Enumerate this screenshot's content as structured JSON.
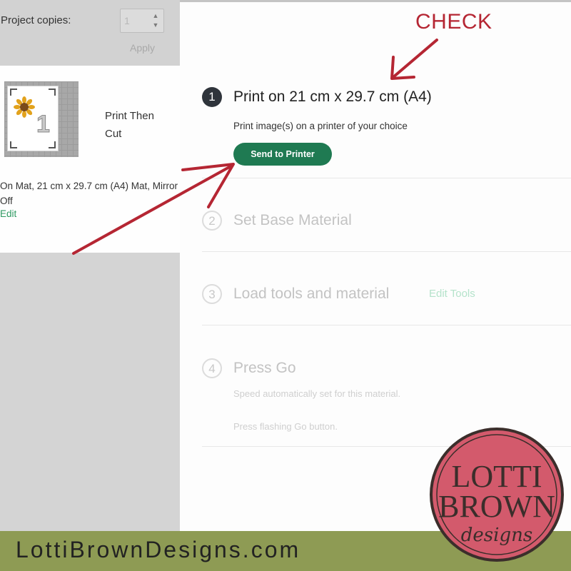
{
  "project_copies": {
    "label": "Project copies:",
    "value": "1",
    "apply_label": "Apply"
  },
  "mat": {
    "number": "1",
    "mode": "Print Then Cut",
    "info": "On Mat, 21 cm x 29.7 cm (A4) Mat, Mirror Off",
    "edit_label": "Edit"
  },
  "steps": [
    {
      "number": "1",
      "title": "Print on 21 cm x 29.7 cm (A4)",
      "description": "Print image(s) on a printer of your choice",
      "button_label": "Send to Printer"
    },
    {
      "number": "2",
      "title": "Set Base Material"
    },
    {
      "number": "3",
      "title": "Load tools and material",
      "link_label": "Edit Tools"
    },
    {
      "number": "4",
      "title": "Press Go",
      "notes": [
        "Speed automatically set for this material.",
        "Press flashing Go button."
      ]
    }
  ],
  "annotation": {
    "label": "CHECK",
    "color": "#b52633"
  },
  "footer": {
    "website": "LottiBrownDesigns.com"
  },
  "logo": {
    "line1": "LOTTI",
    "line2": "BROWN",
    "line3": "designs",
    "color": "#d35a6c"
  },
  "colors": {
    "accent_green": "#1f7a52",
    "link_green": "#2e9a62",
    "footer_bg": "#8e9b54"
  }
}
